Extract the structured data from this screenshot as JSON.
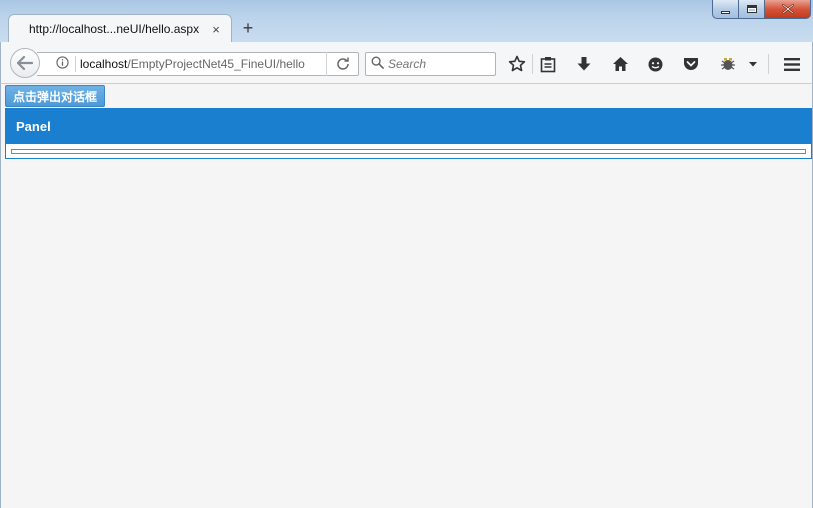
{
  "browser": {
    "tab": {
      "title": "http://localhost...neUI/hello.aspx",
      "close_icon": "×"
    },
    "new_tab_icon": "+",
    "url": {
      "host": "localhost",
      "path": "/EmptyProjectNet45_FineUI/hello"
    },
    "search": {
      "placeholder": "Search"
    }
  },
  "page": {
    "dialog_button_label": "点击弹出对话框",
    "panel_title": "Panel"
  },
  "colors": {
    "accent": "#1b7fcf",
    "button": "#4d9ad8"
  }
}
